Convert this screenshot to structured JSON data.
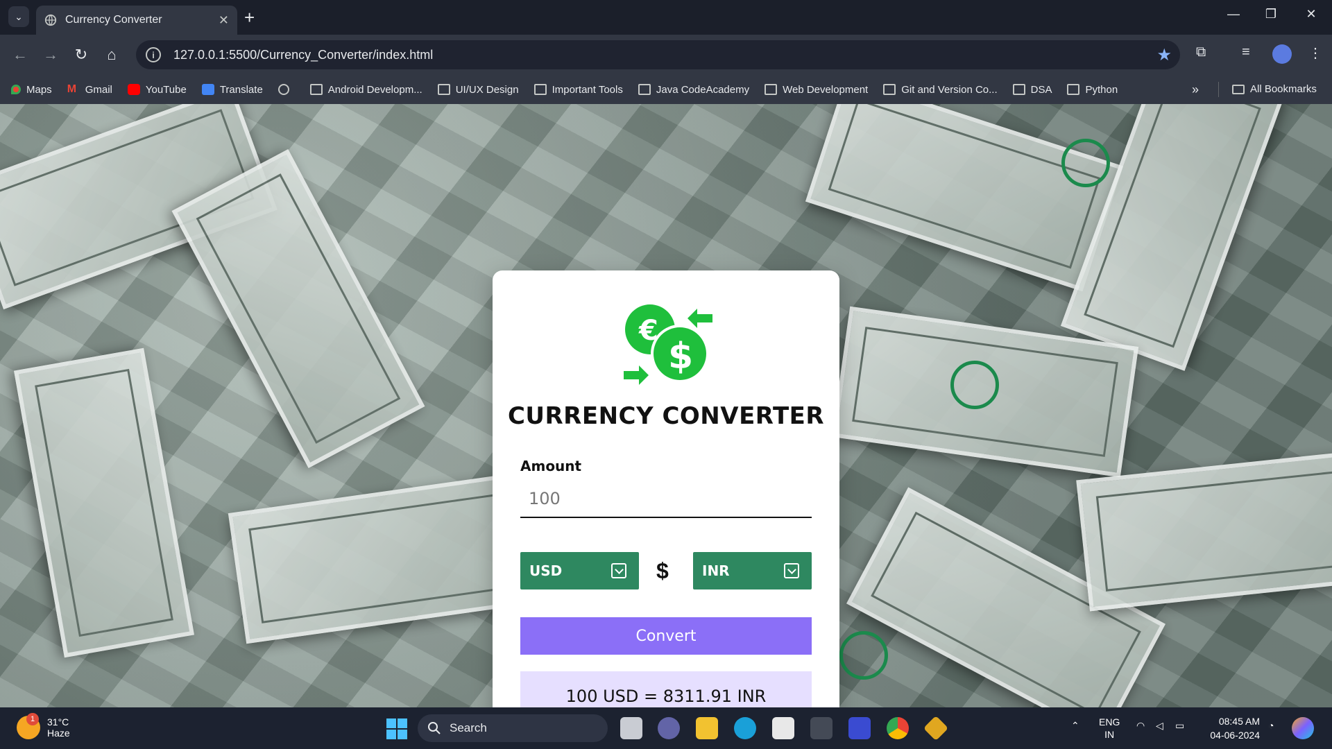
{
  "browser": {
    "tab_title": "Currency Converter",
    "url": "127.0.0.1:5500/Currency_Converter/index.html",
    "bookmarks": [
      {
        "label": "Maps"
      },
      {
        "label": "Gmail"
      },
      {
        "label": "YouTube"
      },
      {
        "label": "Translate"
      },
      {
        "label": ""
      },
      {
        "label": "Android Developm..."
      },
      {
        "label": "UI/UX Design"
      },
      {
        "label": "Important Tools"
      },
      {
        "label": "Java CodeAcademy"
      },
      {
        "label": "Web Development"
      },
      {
        "label": "Git and Version Co..."
      },
      {
        "label": "DSA"
      },
      {
        "label": "Python"
      }
    ],
    "all_bookmarks": "All Bookmarks"
  },
  "app": {
    "title": "CURRENCY CONVERTER",
    "amount_label": "Amount",
    "amount_placeholder": "100",
    "from_currency": "USD",
    "to_currency": "INR",
    "swap_symbol": "$",
    "convert_label": "Convert",
    "result": "100 USD = 8311.91 INR",
    "colors": {
      "select_bg": "#2e8860",
      "button_bg": "#8b6ff7",
      "result_bg": "#e6dfff",
      "logo_green": "#1fbf3c"
    }
  },
  "taskbar": {
    "weather_temp": "31°C",
    "weather_desc": "Haze",
    "weather_badge": "1",
    "search_label": "Search",
    "lang_top": "ENG",
    "lang_bottom": "IN",
    "time": "08:45 AM",
    "date": "04-06-2024"
  }
}
